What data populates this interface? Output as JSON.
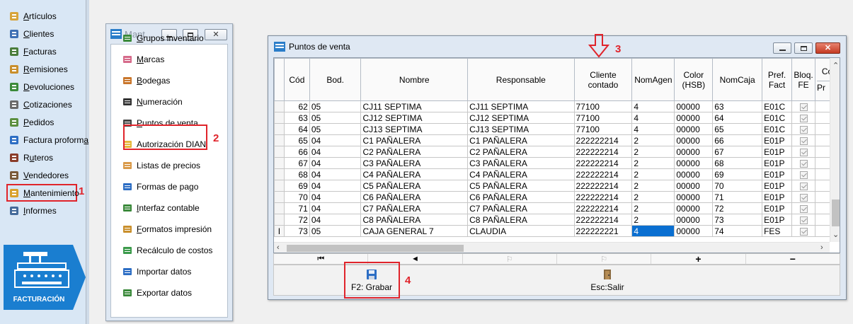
{
  "sidebar": {
    "items": [
      {
        "label_pre": "",
        "underline": "A",
        "label_post": "rtículos",
        "icon": "box-icon"
      },
      {
        "label_pre": "",
        "underline": "C",
        "label_post": "lientes",
        "icon": "person-icon"
      },
      {
        "label_pre": "",
        "underline": "F",
        "label_post": "acturas",
        "icon": "invoice-icon"
      },
      {
        "label_pre": "",
        "underline": "R",
        "label_post": "emisiones",
        "icon": "pencil-doc-icon"
      },
      {
        "label_pre": "",
        "underline": "D",
        "label_post": "evoluciones",
        "icon": "return-doc-icon"
      },
      {
        "label_pre": "",
        "underline": "C",
        "label_post": "otizaciones",
        "icon": "quote-doc-icon"
      },
      {
        "label_pre": "",
        "underline": "P",
        "label_post": "edidos",
        "icon": "order-doc-icon"
      },
      {
        "label_pre": "Factura proform",
        "underline": "a",
        "label_post": "",
        "icon": "proforma-doc-icon"
      },
      {
        "label_pre": "R",
        "underline": "u",
        "label_post": "teros",
        "icon": "truck-icon"
      },
      {
        "label_pre": "",
        "underline": "V",
        "label_post": "endedores",
        "icon": "salesperson-icon"
      },
      {
        "label_pre": "",
        "underline": "M",
        "label_post": "antenimiento",
        "icon": "tools-icon"
      },
      {
        "label_pre": "",
        "underline": "I",
        "label_post": "nformes",
        "icon": "printer-icon"
      }
    ],
    "logo_text": "FACTURACIÓN"
  },
  "annotations": {
    "one": "1",
    "two": "2",
    "three": "3",
    "four": "4"
  },
  "mant_window": {
    "title": "Mant...",
    "items": [
      {
        "label_pre": "",
        "underline": "G",
        "label_post": "rupos inventario",
        "icon": "tree-icon"
      },
      {
        "label_pre": "",
        "underline": "M",
        "label_post": "arcas",
        "icon": "tag-icon"
      },
      {
        "label_pre": "",
        "underline": "B",
        "label_post": "odegas",
        "icon": "house-icon"
      },
      {
        "label_pre": "",
        "underline": "N",
        "label_post": "umeración",
        "icon": "list-numbered-icon"
      },
      {
        "label_pre": "",
        "underline": "P",
        "label_post": "untos de venta",
        "icon": "cash-register-icon"
      },
      {
        "label_pre": "Autorización DIAN",
        "underline": "",
        "label_post": "",
        "icon": "jar-icon"
      },
      {
        "label_pre": "Listas de precios",
        "underline": "",
        "label_post": "",
        "icon": "price-tag-icon"
      },
      {
        "label_pre": "Formas de pago",
        "underline": "",
        "label_post": "",
        "icon": "payment-icon"
      },
      {
        "label_pre": "",
        "underline": "I",
        "label_post": "nterfaz contable",
        "icon": "interface-icon"
      },
      {
        "label_pre": "",
        "underline": "F",
        "label_post": "ormatos impresión",
        "icon": "print-format-icon"
      },
      {
        "label_pre": "Recálculo de costos",
        "underline": "",
        "label_post": "",
        "icon": "recalc-icon"
      },
      {
        "label_pre": "Importar datos",
        "underline": "",
        "label_post": "",
        "icon": "import-icon"
      },
      {
        "label_pre": "Exportar datos",
        "underline": "",
        "label_post": "",
        "icon": "export-icon"
      }
    ]
  },
  "pv_window": {
    "title": "Puntos de venta",
    "columns": [
      {
        "label": "Cód"
      },
      {
        "label": "Bod."
      },
      {
        "label": "Nombre"
      },
      {
        "label": "Responsable"
      },
      {
        "label": "Cliente contado"
      },
      {
        "label": "NomAgen"
      },
      {
        "label": "Color (HSB)"
      },
      {
        "label": "NomCaja"
      },
      {
        "label": "Pref. Fact"
      },
      {
        "label": "Bloq. FE"
      },
      {
        "label": "Co"
      }
    ],
    "partial_col_sub": "Pr",
    "rows": [
      {
        "cod": "62",
        "bod": "05",
        "nombre": "CJ11 SEPTIMA",
        "resp": "CJ11 SEPTIMA",
        "cliente": "77100",
        "agen": "4",
        "color": "00000",
        "caja": "63",
        "pref": "E01C"
      },
      {
        "cod": "63",
        "bod": "05",
        "nombre": "CJ12 SEPTIMA",
        "resp": "CJ12 SEPTIMA",
        "cliente": "77100",
        "agen": "4",
        "color": "00000",
        "caja": "64",
        "pref": "E01C"
      },
      {
        "cod": "64",
        "bod": "05",
        "nombre": "CJ13 SEPTIMA",
        "resp": "CJ13 SEPTIMA",
        "cliente": "77100",
        "agen": "4",
        "color": "00000",
        "caja": "65",
        "pref": "E01C"
      },
      {
        "cod": "65",
        "bod": "04",
        "nombre": "C1 PAÑALERA",
        "resp": "C1 PAÑALERA",
        "cliente": "222222214",
        "agen": "2",
        "color": "00000",
        "caja": "66",
        "pref": "E01P"
      },
      {
        "cod": "66",
        "bod": "04",
        "nombre": "C2 PAÑALERA",
        "resp": "C2 PAÑALERA",
        "cliente": "222222214",
        "agen": "2",
        "color": "00000",
        "caja": "67",
        "pref": "E01P"
      },
      {
        "cod": "67",
        "bod": "04",
        "nombre": "C3 PAÑALERA",
        "resp": "C3 PAÑALERA",
        "cliente": "222222214",
        "agen": "2",
        "color": "00000",
        "caja": "68",
        "pref": "E01P"
      },
      {
        "cod": "68",
        "bod": "04",
        "nombre": "C4 PAÑALERA",
        "resp": "C4 PAÑALERA",
        "cliente": "222222214",
        "agen": "2",
        "color": "00000",
        "caja": "69",
        "pref": "E01P"
      },
      {
        "cod": "69",
        "bod": "04",
        "nombre": "C5 PAÑALERA",
        "resp": "C5 PAÑALERA",
        "cliente": "222222214",
        "agen": "2",
        "color": "00000",
        "caja": "70",
        "pref": "E01P"
      },
      {
        "cod": "70",
        "bod": "04",
        "nombre": "C6 PAÑALERA",
        "resp": "C6 PAÑALERA",
        "cliente": "222222214",
        "agen": "2",
        "color": "00000",
        "caja": "71",
        "pref": "E01P"
      },
      {
        "cod": "71",
        "bod": "04",
        "nombre": "C7 PAÑALERA",
        "resp": "C7 PAÑALERA",
        "cliente": "222222214",
        "agen": "2",
        "color": "00000",
        "caja": "72",
        "pref": "E01P"
      },
      {
        "cod": "72",
        "bod": "04",
        "nombre": "C8 PAÑALERA",
        "resp": "C8 PAÑALERA",
        "cliente": "222222214",
        "agen": "2",
        "color": "00000",
        "caja": "73",
        "pref": "E01P"
      },
      {
        "cod": "73",
        "bod": "05",
        "nombre": "CAJA GENERAL 7",
        "resp": "CLAUDIA",
        "cliente": "222222221",
        "agen": "4",
        "color": "00000",
        "caja": "74",
        "pref": "FES"
      }
    ],
    "edit_row_indicator": "I",
    "nav": {
      "first": "⏮",
      "prev": "◄",
      "next": "⚐",
      "last": "⚐",
      "add": "+",
      "delete": "−"
    },
    "footer": {
      "save_label": "F2: Grabar",
      "exit_label": "Esc:Salir"
    }
  },
  "colors": {
    "accent_red": "#e0242b",
    "selection_blue": "#0a6fd1",
    "sidebar_bg": "#d9e7f5",
    "logo_blue": "#1a7ed0"
  }
}
